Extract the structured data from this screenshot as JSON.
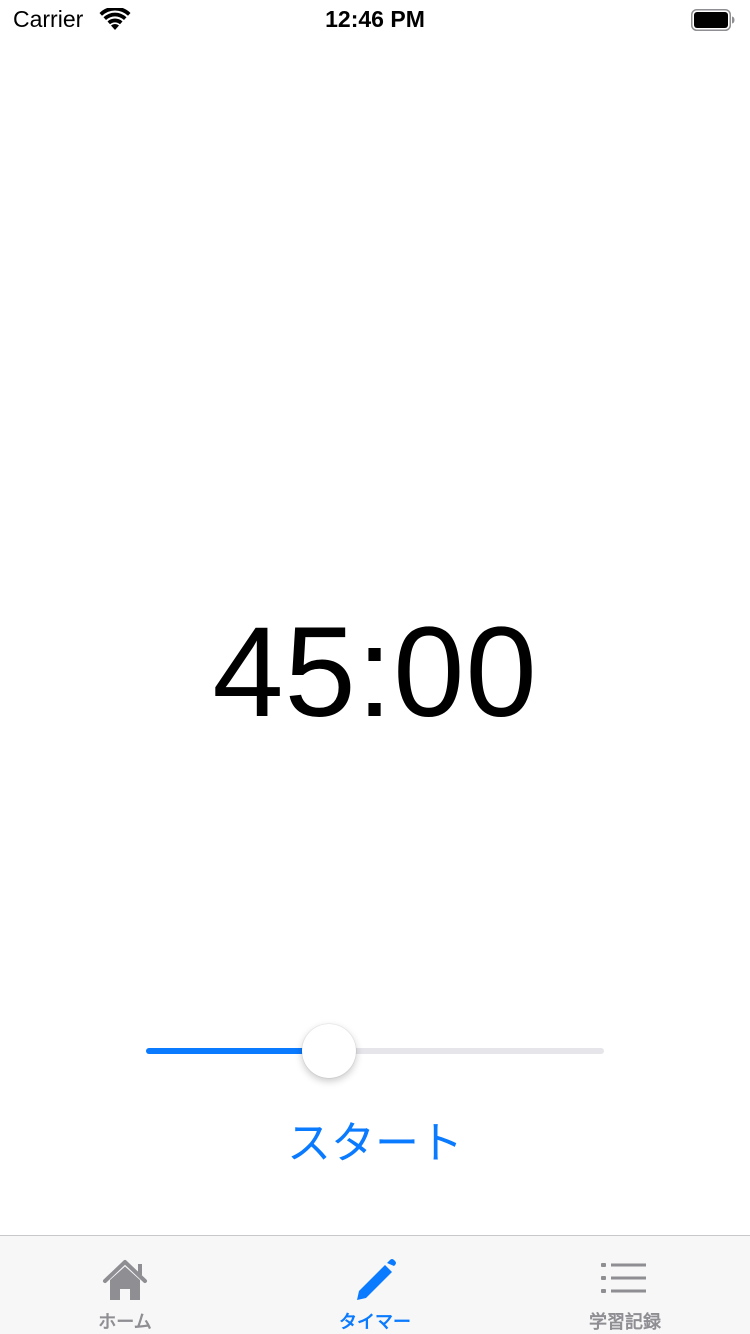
{
  "status_bar": {
    "carrier": "Carrier",
    "time": "12:46 PM",
    "wifi_icon": "wifi-icon",
    "battery_icon": "battery-icon"
  },
  "timer": {
    "display": "45:00"
  },
  "slider": {
    "value_fraction": 0.4
  },
  "start_button": {
    "label": "スタート"
  },
  "tab_bar": {
    "tabs": [
      {
        "label": "ホーム",
        "icon": "house-icon",
        "active": false
      },
      {
        "label": "タイマー",
        "icon": "pencil-icon",
        "active": true
      },
      {
        "label": "学習記録",
        "icon": "list-icon",
        "active": false
      }
    ]
  },
  "colors": {
    "accent": "#0a7aff",
    "inactive": "#8e8e93",
    "track": "#e5e5ea",
    "tab_bar_bg": "#f7f7f7"
  }
}
